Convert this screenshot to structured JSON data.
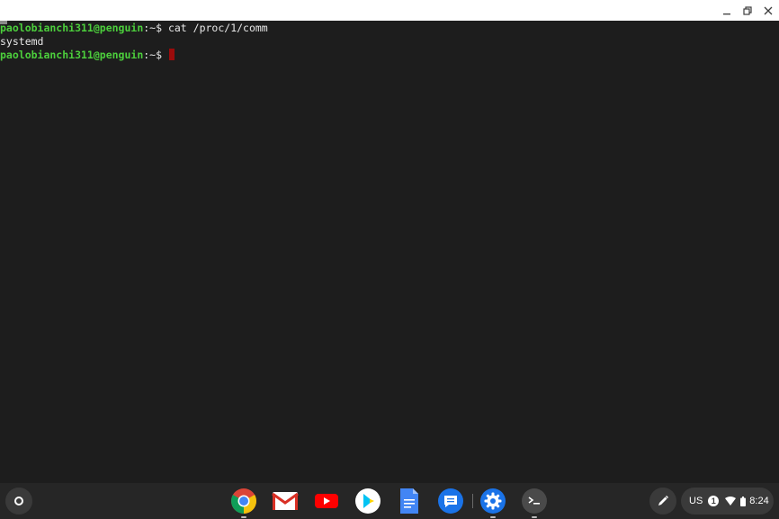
{
  "window": {
    "controls": [
      "minimize",
      "maximize",
      "close"
    ]
  },
  "terminal": {
    "lines": [
      {
        "user": "paolobianchi311@penguin",
        "sep": ":~$ ",
        "command": "cat /proc/1/comm"
      },
      {
        "output": "systemd"
      },
      {
        "user": "paolobianchi311@penguin",
        "sep": ":~$ ",
        "command": ""
      }
    ],
    "colors": {
      "prompt": "#4ccf3c",
      "cursor": "#9b0b0b",
      "background": "#1d1d1d"
    }
  },
  "shelf": {
    "apps": [
      "chrome-icon",
      "gmail-icon",
      "youtube-icon",
      "play-store-icon",
      "docs-icon",
      "messages-icon",
      "settings-icon",
      "terminal-icon"
    ],
    "tray": {
      "ime": "US",
      "notification_count": "1",
      "time": "8:24"
    }
  }
}
